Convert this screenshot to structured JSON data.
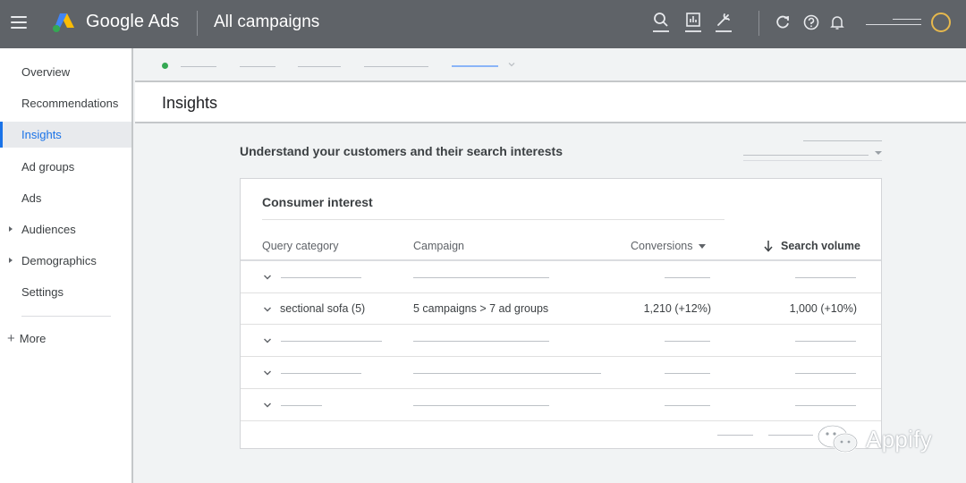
{
  "header": {
    "brand": "Google Ads",
    "campaign_title": "All campaigns",
    "icons": [
      "search-icon",
      "reports-icon",
      "tools-icon",
      "refresh-icon",
      "help-icon",
      "notifications-icon"
    ]
  },
  "sidebar": {
    "items": [
      {
        "label": "Overview",
        "active": false,
        "expandable": false
      },
      {
        "label": "Recommendations",
        "active": false,
        "expandable": false
      },
      {
        "label": "Insights",
        "active": true,
        "expandable": false
      },
      {
        "label": "Ad groups",
        "active": false,
        "expandable": false
      },
      {
        "label": "Ads",
        "active": false,
        "expandable": false
      },
      {
        "label": "Audiences",
        "active": false,
        "expandable": true
      },
      {
        "label": "Demographics",
        "active": false,
        "expandable": true
      },
      {
        "label": "Settings",
        "active": false,
        "expandable": false
      }
    ],
    "more_label": "More"
  },
  "page": {
    "title": "Insights",
    "section_heading": "Understand your customers and their search interests"
  },
  "card": {
    "title": "Consumer interest",
    "columns": {
      "query": "Query category",
      "campaign": "Campaign",
      "conversions": "Conversions",
      "volume": "Search volume"
    },
    "row": {
      "query": "sectional sofa (5)",
      "campaign": "5 campaigns > 7 ad groups",
      "conversions": "1,210 (+12%)",
      "volume": "1,000 (+10%)"
    }
  },
  "watermark": {
    "text": "Appify"
  },
  "colors": {
    "topbar": "#5f6368",
    "accent": "#1a73e8",
    "status_dot": "#34a853",
    "avatar_ring": "#e6b84d"
  }
}
